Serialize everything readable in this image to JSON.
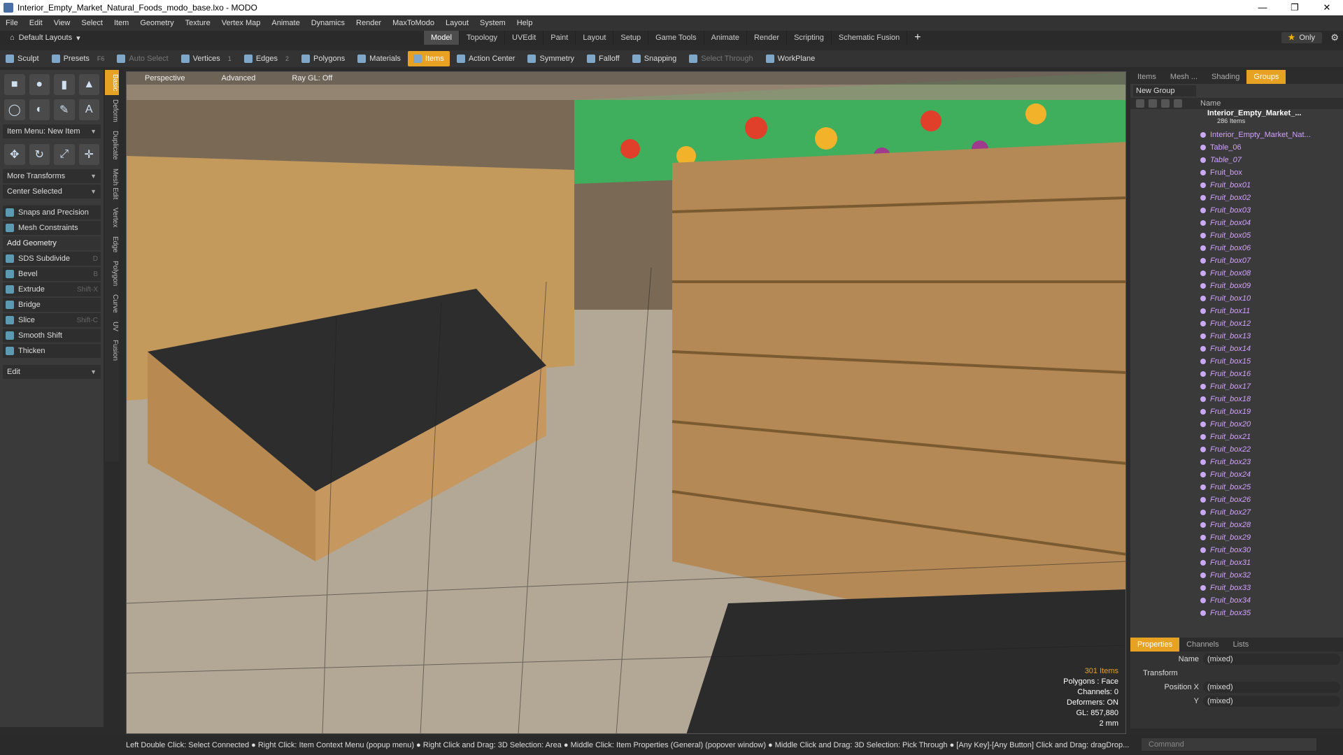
{
  "window": {
    "title": "Interior_Empty_Market_Natural_Foods_modo_base.lxo - MODO",
    "min": "—",
    "max": "❐",
    "close": "✕"
  },
  "menu": [
    "File",
    "Edit",
    "View",
    "Select",
    "Item",
    "Geometry",
    "Texture",
    "Vertex Map",
    "Animate",
    "Dynamics",
    "Render",
    "MaxToModo",
    "Layout",
    "System",
    "Help"
  ],
  "layout": {
    "default": "Default Layouts",
    "tabs": [
      "Model",
      "Topology",
      "UVEdit",
      "Paint",
      "Layout",
      "Setup",
      "Game Tools",
      "Animate",
      "Render",
      "Scripting",
      "Schematic Fusion"
    ],
    "active_tab": "Model",
    "only": "Only"
  },
  "toolbar": {
    "sculpt": "Sculpt",
    "presets": "Presets",
    "presets_key": "F6",
    "auto_select": "Auto Select",
    "vertices": "Vertices",
    "vertices_n": "1",
    "edges": "Edges",
    "edges_n": "2",
    "polygons": "Polygons",
    "materials": "Materials",
    "items": "Items",
    "action_center": "Action Center",
    "symmetry": "Symmetry",
    "falloff": "Falloff",
    "snapping": "Snapping",
    "select_through": "Select Through",
    "workplane": "WorkPlane"
  },
  "left": {
    "item_menu": "Item Menu: New Item",
    "more_transforms": "More Transforms",
    "center_selected": "Center Selected",
    "snaps": "Snaps and Precision",
    "mesh_constraints": "Mesh Constraints",
    "add_geometry": "Add Geometry",
    "tools": [
      {
        "label": "SDS Subdivide",
        "key": "D"
      },
      {
        "label": "Bevel",
        "key": "B"
      },
      {
        "label": "Extrude",
        "key": "Shift-X"
      },
      {
        "label": "Bridge",
        "key": ""
      },
      {
        "label": "Slice",
        "key": "Shift-C"
      },
      {
        "label": "Smooth Shift",
        "key": ""
      },
      {
        "label": "Thicken",
        "key": ""
      }
    ],
    "edit": "Edit",
    "vtabs": [
      "Basic",
      "Deform",
      "Duplicate",
      "Mesh Edit",
      "Vertex",
      "Edge",
      "Polygon",
      "Curve",
      "UV",
      "Fusion"
    ]
  },
  "viewport": {
    "mode": "Perspective",
    "advanced": "Advanced",
    "raygl": "Ray GL: Off",
    "stats": {
      "items": "301 Items",
      "polygons": "Polygons : Face",
      "channels": "Channels: 0",
      "deformers": "Deformers: ON",
      "gl": "GL: 857,880",
      "scale": "2 mm"
    }
  },
  "right": {
    "tabs": [
      "Items",
      "Mesh ...",
      "Shading",
      "Groups"
    ],
    "active": "Groups",
    "new_group": "New Group",
    "name_col": "Name",
    "group_name": "Interior_Empty_Market_...",
    "group_count": "286 Items",
    "items": [
      "Interior_Empty_Market_Nat...",
      "Table_06",
      "Table_07",
      "Fruit_box",
      "Fruit_box01",
      "Fruit_box02",
      "Fruit_box03",
      "Fruit_box04",
      "Fruit_box05",
      "Fruit_box06",
      "Fruit_box07",
      "Fruit_box08",
      "Fruit_box09",
      "Fruit_box10",
      "Fruit_box11",
      "Fruit_box12",
      "Fruit_box13",
      "Fruit_box14",
      "Fruit_box15",
      "Fruit_box16",
      "Fruit_box17",
      "Fruit_box18",
      "Fruit_box19",
      "Fruit_box20",
      "Fruit_box21",
      "Fruit_box22",
      "Fruit_box23",
      "Fruit_box24",
      "Fruit_box25",
      "Fruit_box26",
      "Fruit_box27",
      "Fruit_box28",
      "Fruit_box29",
      "Fruit_box30",
      "Fruit_box31",
      "Fruit_box32",
      "Fruit_box33",
      "Fruit_box34",
      "Fruit_box35"
    ]
  },
  "props": {
    "tabs": [
      "Properties",
      "Channels",
      "Lists"
    ],
    "name_label": "Name",
    "name_val": "(mixed)",
    "transform": "Transform",
    "posx_label": "Position X",
    "posx_val": "(mixed)",
    "y_label": "Y",
    "y_val": "(mixed)"
  },
  "status": "Left Double Click: Select Connected ● Right Click: Item Context Menu (popup menu) ● Right Click and Drag: 3D Selection: Area ● Middle Click: Item Properties (General) (popover window) ● Middle Click and Drag: 3D Selection: Pick Through ● [Any Key]-[Any Button] Click and Drag: dragDrop...",
  "command": "Command"
}
